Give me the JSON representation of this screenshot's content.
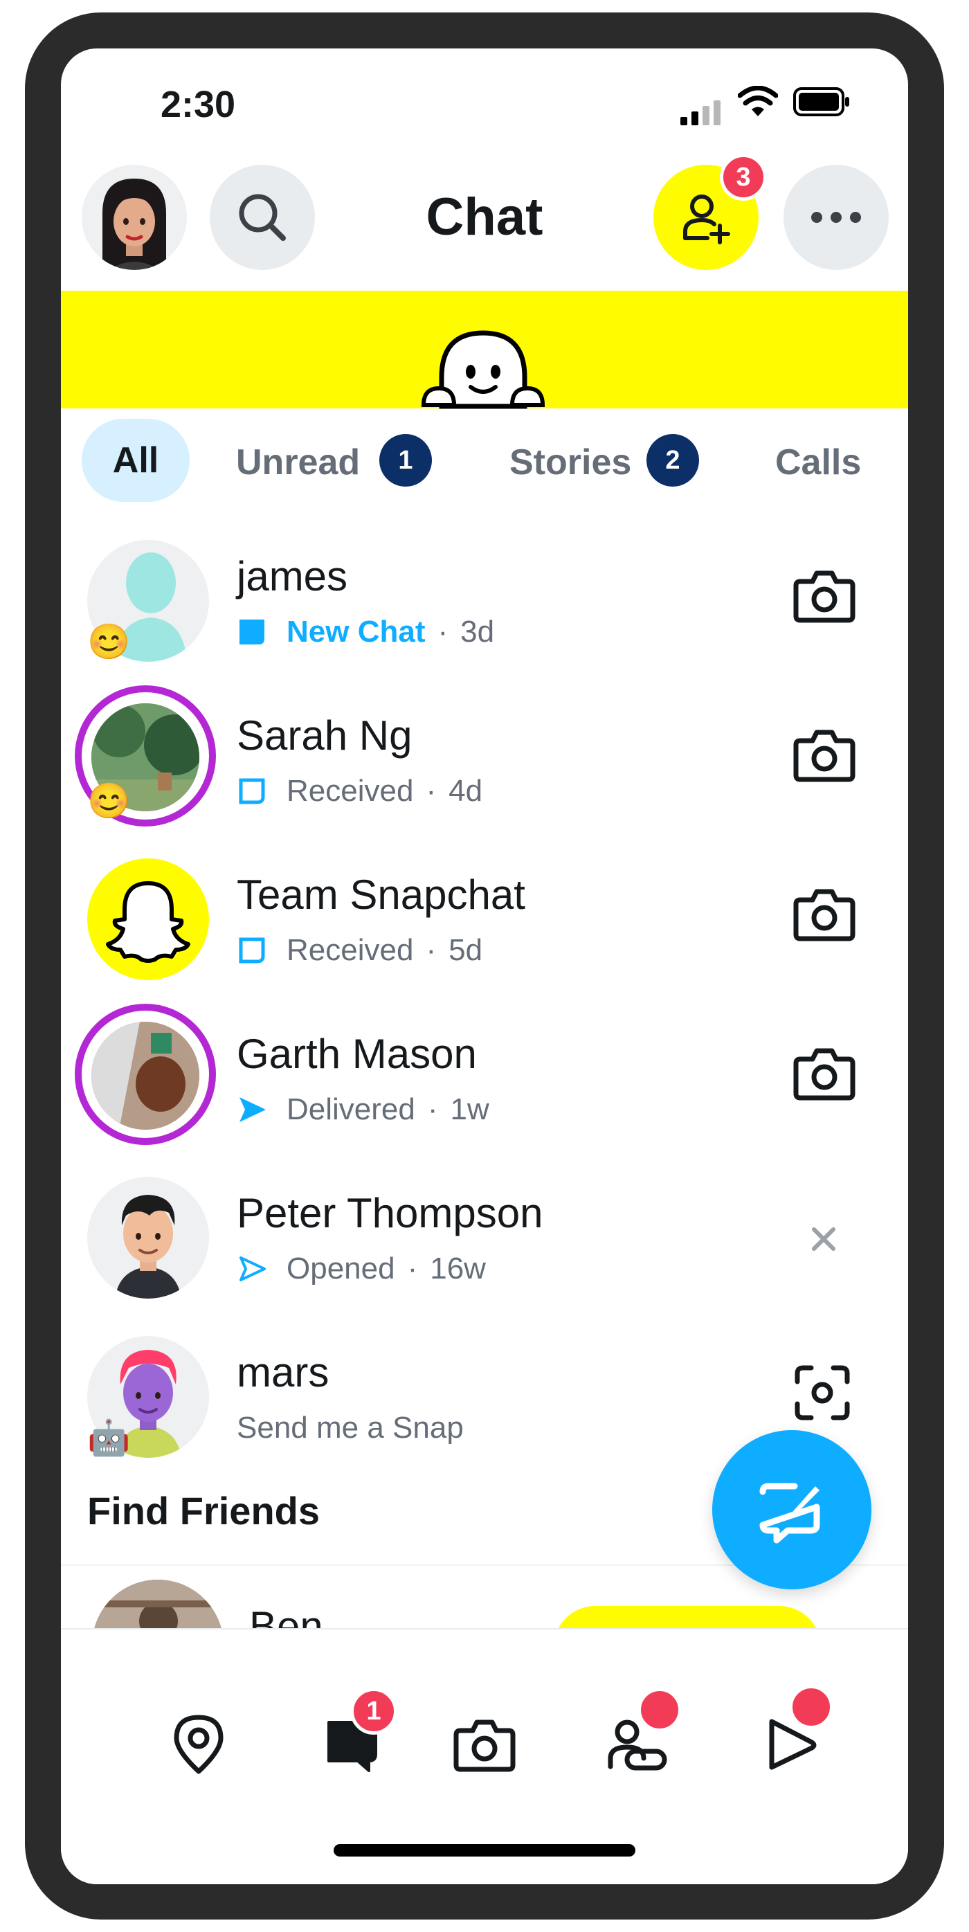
{
  "status_bar": {
    "time": "2:30"
  },
  "header": {
    "title": "Chat",
    "add_friends_badge": "3"
  },
  "tabs": [
    {
      "label": "All"
    },
    {
      "label": "Unread",
      "count": "1"
    },
    {
      "label": "Stories",
      "count": "2"
    },
    {
      "label": "Calls"
    }
  ],
  "chats": [
    {
      "name": "james",
      "status": "New Chat",
      "dot": "·",
      "time": "3d",
      "emoji": "😊"
    },
    {
      "name": "Sarah Ng",
      "status": "Received",
      "dot": "·",
      "time": "4d",
      "emoji": "😊"
    },
    {
      "name": "Team Snapchat",
      "status": "Received",
      "dot": "·",
      "time": "5d"
    },
    {
      "name": "Garth Mason",
      "status": "Delivered",
      "dot": "·",
      "time": "1w"
    },
    {
      "name": "Peter Thompson",
      "status": "Opened",
      "dot": "·",
      "time": "16w"
    },
    {
      "name": "mars",
      "subtitle": "Send me a Snap",
      "emoji": "🤖"
    }
  ],
  "find_friends": {
    "title": "Find Friends",
    "first_name": "Ben"
  },
  "nav": {
    "chat_badge": "1"
  },
  "colors": {
    "snap_yellow": "#fffc00",
    "accent_blue": "#0fadff",
    "story_ring": "#b427d4",
    "badge_red": "#f23c57",
    "pill_navy": "#0d2f68"
  }
}
